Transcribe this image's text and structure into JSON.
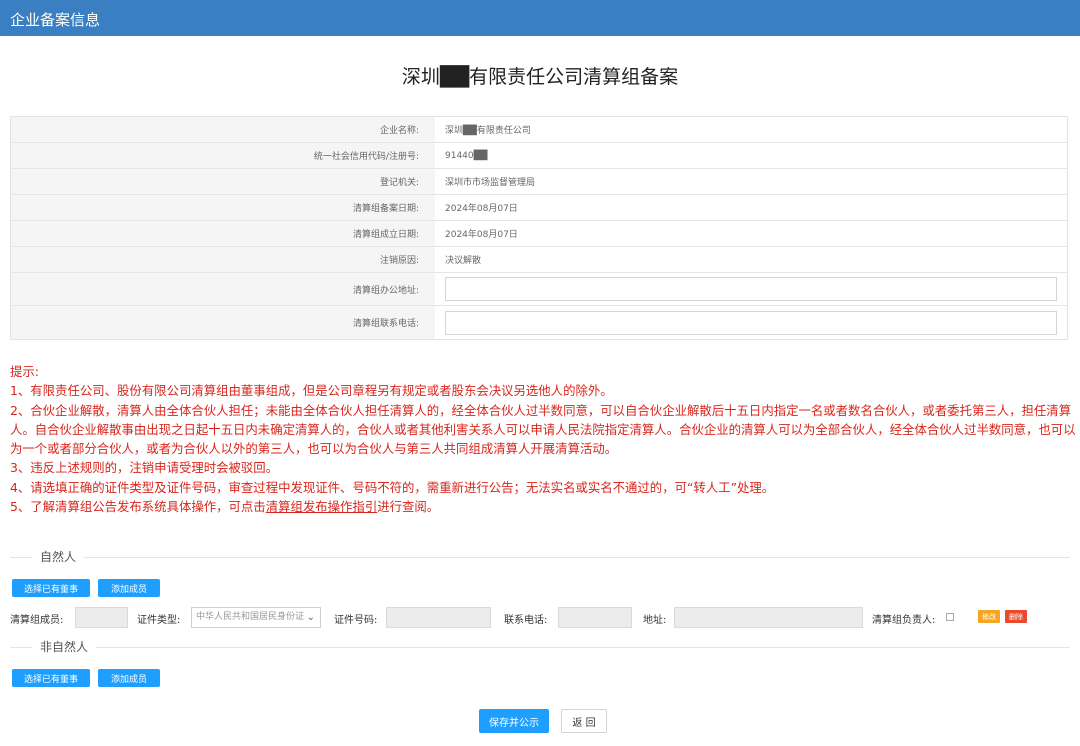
{
  "colors": {
    "header": "#3a7fc1",
    "primary_button": "#1e9fff",
    "tip_text": "#d9261c",
    "tag_edit": "#f5a623",
    "tag_delete": "#e84a2e"
  },
  "header": {
    "title": "企业备案信息"
  },
  "page": {
    "title": "深圳██有限责任公司清算组备案"
  },
  "info": {
    "company_name": {
      "label": "企业名称:",
      "value": "深圳██有限责任公司"
    },
    "credit_code": {
      "label": "统一社会信用代码/注册号:",
      "value": "91440██"
    },
    "registration_authority": {
      "label": "登记机关:",
      "value": "深圳市市场监督管理局"
    },
    "filing_date": {
      "label": "清算组备案日期:",
      "value": "2024年08月07日"
    },
    "established_date": {
      "label": "清算组成立日期:",
      "value": "2024年08月07日"
    },
    "cancel_reason": {
      "label": "注销原因:",
      "value": "决议解散"
    },
    "office_address": {
      "label": "清算组办公地址:",
      "value": ""
    },
    "contact_phone": {
      "label": "清算组联系电话:",
      "value": ""
    }
  },
  "tips": {
    "heading": "提示:",
    "items": [
      "1、有限责任公司、股份有限公司清算组由董事组成，但是公司章程另有规定或者股东会决议另选他人的除外。",
      "2、合伙企业解散，清算人由全体合伙人担任；未能由全体合伙人担任清算人的，经全体合伙人过半数同意，可以自合伙企业解散后十五日内指定一名或者数名合伙人，或者委托第三人，担任清算人。自合伙企业解散事由出现之日起十五日内未确定清算人的，合伙人或者其他利害关系人可以申请人民法院指定清算人。合伙企业的清算人可以为全部合伙人，经全体合伙人过半数同意，也可以为一个或者部分合伙人，或者为合伙人以外的第三人，也可以为合伙人与第三人共同组成清算人开展清算活动。",
      "3、违反上述规则的，注销申请受理时会被驳回。",
      "4、请选填正确的证件类型及证件号码，审查过程中发现证件、号码不符的，需重新进行公告；无法实名或实名不通过的，可“转人工”处理。"
    ],
    "item5_prefix": "5、了解清算组公告发布系统具体操作，可点击",
    "item5_link": "清算组发布操作指引",
    "item5_suffix": "进行查阅。"
  },
  "natural_person": {
    "section_label": "自然人",
    "select_director_button": "选择已有董事",
    "add_member_button": "添加成员",
    "member": {
      "member_label": "清算组成员:",
      "member_value": "",
      "id_type_label": "证件类型:",
      "id_type_value": "中华人民共和国居民身份证",
      "id_number_label": "证件号码:",
      "id_number_value": "",
      "phone_label": "联系电话:",
      "phone_value": "",
      "address_label": "地址:",
      "address_value": "",
      "leader_label": "清算组负责人:",
      "edit_tag": "修改",
      "delete_tag": "删除"
    }
  },
  "non_natural_person": {
    "section_label": "非自然人",
    "select_director_button": "选择已有董事",
    "add_member_button": "添加成员"
  },
  "footer": {
    "save_button": "保存并公示",
    "back_button": "返 回"
  }
}
